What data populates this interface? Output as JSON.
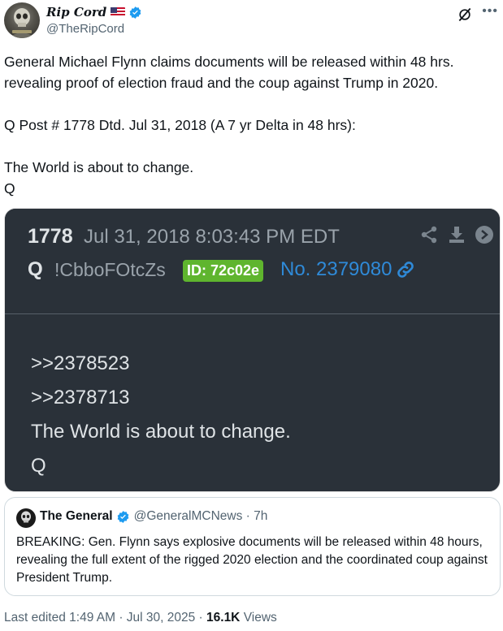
{
  "author": {
    "display_name": "Rip Cord",
    "handle": "@TheRipCord",
    "flag": "us-flag-icon",
    "verified": "verified-badge-icon"
  },
  "tweet": {
    "paragraph1": "General Michael Flynn claims documents will be released within 48 hrs. revealing proof of election fraud and the coup against Trump in 2020.",
    "paragraph2": "Q Post # 1778 Dtd. Jul 31, 2018 (A 7 yr Delta in 48 hrs):",
    "paragraph3": "The World is about to change.",
    "paragraph4": "Q"
  },
  "media": {
    "post_number": "1778",
    "post_date": "Jul 31, 2018 8:03:43 PM EDT",
    "q_label": "Q",
    "tripcode": "!CbboFOtcZs",
    "id_badge": "ID: 72c02e",
    "post_no": "No. 2379080",
    "line1": ">>2378523",
    "line2": ">>2378713",
    "line3": "The World is about to change.",
    "line4": "Q",
    "icons": [
      "share-icon",
      "download-icon",
      "arrow-right-icon",
      "link-icon"
    ]
  },
  "quote": {
    "name": "The General",
    "handle_time": "@GeneralMCNews · 7h",
    "text": "BREAKING: Gen. Flynn says explosive documents will be released within 48 hours, revealing the full extent of the rigged 2020 election and the coordinated coup against President Trump."
  },
  "footer": {
    "edited_label": "Last edited 1:49 AM · Jul 30, 2025 · ",
    "views_count": "16.1K",
    "views_label": " Views"
  },
  "colors": {
    "media_bg": "#2a3139",
    "id_badge_bg": "#5fb52e",
    "post_no_blue": "#2f8ad8",
    "verified_blue": "#1d9bf0"
  }
}
